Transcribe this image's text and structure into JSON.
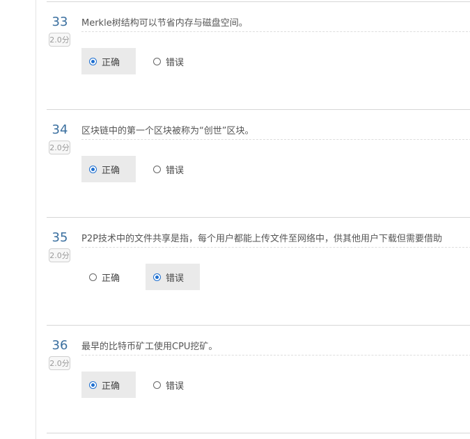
{
  "questions": [
    {
      "number": "33",
      "score": "2.0分",
      "text": "Merkle树结构可以节省内存与磁盘空间。",
      "options": [
        {
          "label": "正确",
          "selected": true
        },
        {
          "label": "错误",
          "selected": false
        }
      ]
    },
    {
      "number": "34",
      "score": "2.0分",
      "text": "区块链中的第一个区块被称为“创世”区块。",
      "options": [
        {
          "label": "正确",
          "selected": true
        },
        {
          "label": "错误",
          "selected": false
        }
      ]
    },
    {
      "number": "35",
      "score": "2.0分",
      "text": "P2P技术中的文件共享是指，每个用户都能上传文件至网络中，供其他用户下载但需要借助",
      "options": [
        {
          "label": "正确",
          "selected": false
        },
        {
          "label": "错误",
          "selected": true
        }
      ]
    },
    {
      "number": "36",
      "score": "2.0分",
      "text": "最早的比特币矿工使用CPU挖矿。",
      "options": [
        {
          "label": "正确",
          "selected": true
        },
        {
          "label": "错误",
          "selected": false
        }
      ]
    }
  ]
}
